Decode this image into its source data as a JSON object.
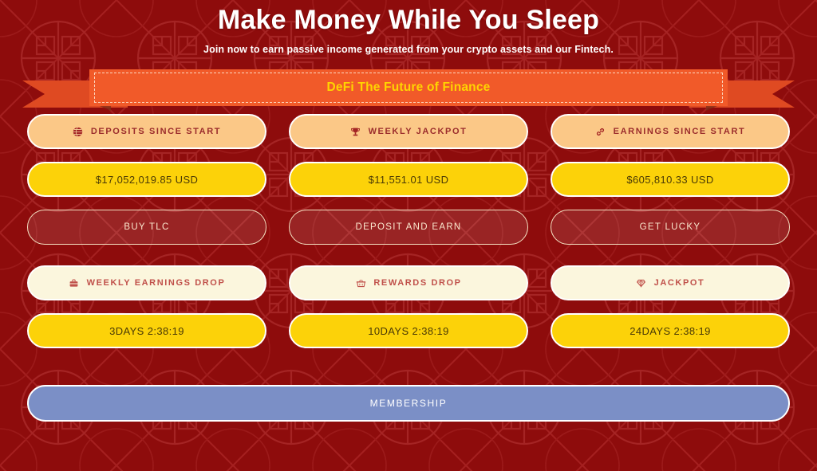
{
  "header": {
    "title": "Make Money While You Sleep",
    "subtitle": "Join now to earn passive income generated from your crypto assets and our Fintech."
  },
  "ribbon": {
    "text": "DeFi The Future of Finance"
  },
  "stats": {
    "labels": [
      {
        "text": "DEPOSITS SINCE START",
        "icon": "globe-icon"
      },
      {
        "text": "WEEKLY JACKPOT",
        "icon": "trophy-icon"
      },
      {
        "text": "EARNINGS SINCE START",
        "icon": "link-icon"
      }
    ],
    "values": [
      "$17,052,019.85 USD",
      "$11,551.01 USD",
      "$605,810.33 USD"
    ],
    "actions": [
      "BUY TLC",
      "DEPOSIT AND EARN",
      "GET LUCKY"
    ]
  },
  "drops": {
    "labels": [
      {
        "text": "WEEKLY EARNINGS DROP",
        "icon": "briefcase-icon"
      },
      {
        "text": "REWARDS DROP",
        "icon": "basket-icon"
      },
      {
        "text": "JACKPOT",
        "icon": "gem-icon"
      }
    ],
    "countdowns": [
      "3DAYS 2:38:19",
      "10DAYS 2:38:19",
      "24DAYS 2:38:19"
    ]
  },
  "membership": {
    "label": "MEMBERSHIP"
  },
  "colors": {
    "background_red": "#8e0c0c",
    "ribbon_orange": "#f15a29",
    "ribbon_text_yellow": "#ffd400",
    "label_orange": "#fbc887",
    "label_cream": "#fbf6dd",
    "value_yellow": "#fcd209",
    "membership_blue": "#7b8fc6"
  }
}
